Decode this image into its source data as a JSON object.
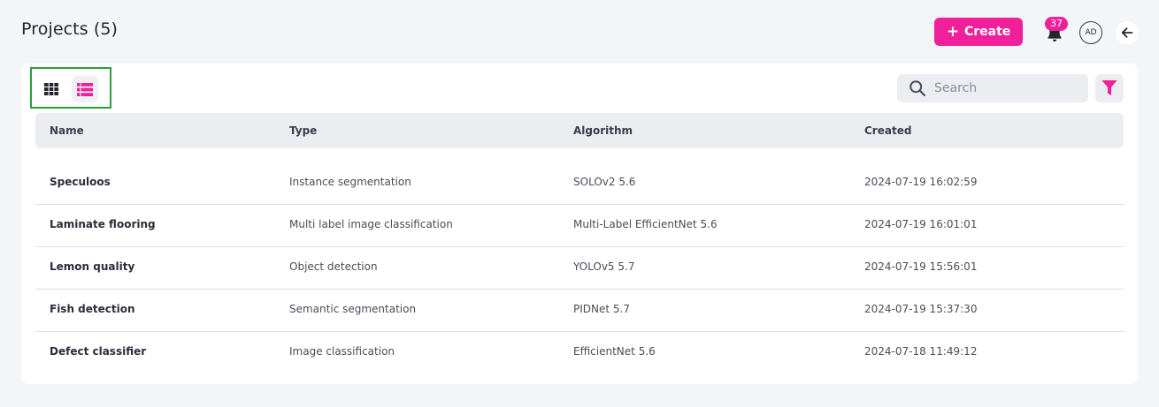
{
  "header": {
    "title": "Projects (5)",
    "create_label": "Create",
    "notification_count": "37",
    "avatar_initials": "AD"
  },
  "colors": {
    "accent": "#f0209a",
    "highlight_border": "#2e9c3c"
  },
  "toolbar": {
    "search_placeholder": "Search",
    "view_modes": [
      "grid",
      "list"
    ],
    "active_view": "list"
  },
  "table": {
    "columns": [
      "Name",
      "Type",
      "Algorithm",
      "Created"
    ],
    "rows": [
      [
        "Speculoos",
        "Instance segmentation",
        "SOLOv2 5.6",
        "2024-07-19 16:02:59"
      ],
      [
        "Laminate flooring",
        "Multi label image classification",
        "Multi-Label EfficientNet 5.6",
        "2024-07-19 16:01:01"
      ],
      [
        "Lemon quality",
        "Object detection",
        "YOLOv5 5.7",
        "2024-07-19 15:56:01"
      ],
      [
        "Fish detection",
        "Semantic segmentation",
        "PIDNet 5.7",
        "2024-07-19 15:37:30"
      ],
      [
        "Defect classifier",
        "Image classification",
        "EfficientNet 5.6",
        "2024-07-18 11:49:12"
      ]
    ]
  }
}
